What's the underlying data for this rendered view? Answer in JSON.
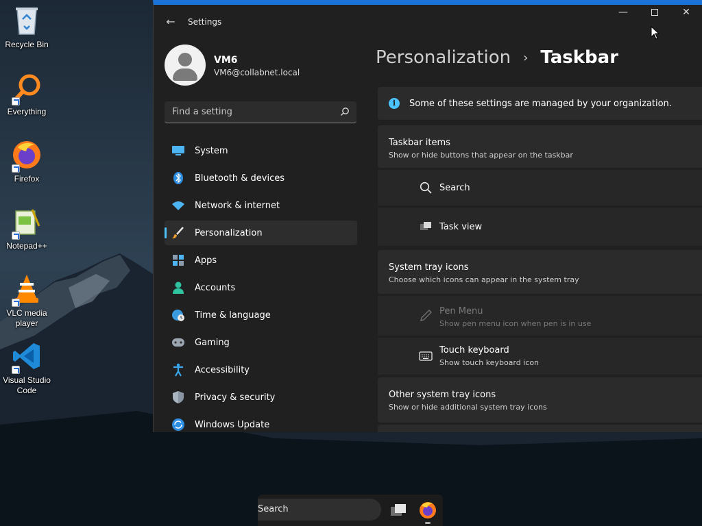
{
  "desktop": {
    "icons": [
      {
        "label": "Recycle Bin",
        "icon": "recycle-bin-icon"
      },
      {
        "label": "Everything",
        "icon": "everything-search-icon"
      },
      {
        "label": "Firefox",
        "icon": "firefox-icon"
      },
      {
        "label": "Notepad++",
        "icon": "notepadpp-icon"
      },
      {
        "label": "VLC media player",
        "icon": "vlc-icon"
      },
      {
        "label": "Visual Studio Code",
        "icon": "vscode-icon"
      }
    ]
  },
  "window": {
    "title": "Settings",
    "back": "←",
    "minimize": "—",
    "close": "✕",
    "accent": "#1a74d9"
  },
  "profile": {
    "name": "VM6",
    "email": "VM6@collabnet.local"
  },
  "search": {
    "placeholder": "Find a setting"
  },
  "nav": {
    "items": [
      {
        "label": "System",
        "icon": "monitor-icon"
      },
      {
        "label": "Bluetooth & devices",
        "icon": "bluetooth-icon"
      },
      {
        "label": "Network & internet",
        "icon": "wifi-icon"
      },
      {
        "label": "Personalization",
        "icon": "brush-icon",
        "active": true
      },
      {
        "label": "Apps",
        "icon": "apps-icon"
      },
      {
        "label": "Accounts",
        "icon": "person-icon"
      },
      {
        "label": "Time & language",
        "icon": "globe-clock-icon"
      },
      {
        "label": "Gaming",
        "icon": "gamepad-icon"
      },
      {
        "label": "Accessibility",
        "icon": "accessibility-icon"
      },
      {
        "label": "Privacy & security",
        "icon": "shield-icon"
      },
      {
        "label": "Windows Update",
        "icon": "update-icon"
      }
    ]
  },
  "breadcrumb": {
    "parent": "Personalization",
    "separator": "›",
    "current": "Taskbar"
  },
  "banner": {
    "icon": "i",
    "text": "Some of these settings are managed by your organization."
  },
  "sections": {
    "taskbar_items": {
      "title": "Taskbar items",
      "subtitle": "Show or hide buttons that appear on the taskbar",
      "rows": [
        {
          "label": "Search",
          "icon": "search-icon"
        },
        {
          "label": "Task view",
          "icon": "task-view-icon"
        }
      ]
    },
    "system_tray": {
      "title": "System tray icons",
      "subtitle": "Choose which icons can appear in the system tray",
      "rows": [
        {
          "label": "Pen Menu",
          "sub": "Show pen menu icon when pen is in use",
          "icon": "pen-icon",
          "disabled": true
        },
        {
          "label": "Touch keyboard",
          "sub": "Show touch keyboard icon",
          "icon": "keyboard-icon"
        }
      ]
    },
    "other_tray": {
      "title": "Other system tray icons",
      "subtitle": "Show or hide additional system tray icons"
    }
  },
  "taskbar": {
    "search_label": "Search",
    "apps": [
      "task-view-icon",
      "firefox-icon"
    ]
  }
}
